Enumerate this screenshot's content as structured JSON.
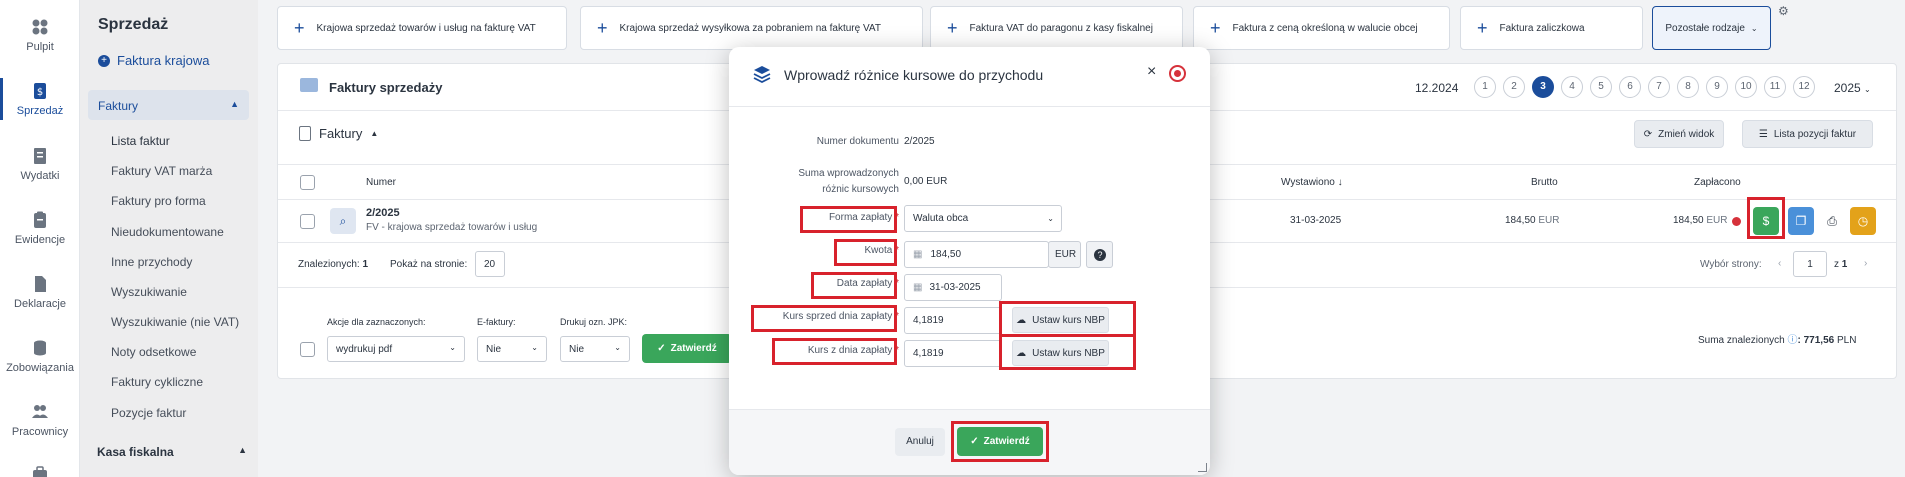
{
  "rail": {
    "items": [
      {
        "label": "Pulpit"
      },
      {
        "label": "Sprzedaż"
      },
      {
        "label": "Wydatki"
      },
      {
        "label": "Ewidencje"
      },
      {
        "label": "Deklaracje"
      },
      {
        "label": "Zobowiązania"
      },
      {
        "label": "Pracownicy"
      }
    ]
  },
  "sidebar": {
    "title": "Sprzedaż",
    "new_invoice": "Faktura krajowa",
    "group": "Faktury",
    "items": [
      "Lista faktur",
      "Faktury VAT marża",
      "Faktury pro forma",
      "Nieudokumentowane",
      "Inne przychody",
      "Wyszukiwanie",
      "Wyszukiwanie (nie VAT)",
      "Noty odsetkowe",
      "Faktury cykliczne",
      "Pozycje faktur"
    ],
    "group2": "Kasa fiskalna"
  },
  "topbar": {
    "buttons": [
      "Krajowa sprzedaż towarów i usług na fakturę VAT",
      "Krajowa sprzedaż wysyłkowa za pobraniem na fakturę VAT",
      "Faktura VAT do paragonu z kasy fiskalnej",
      "Faktura z ceną określoną w walucie obcej",
      "Faktura zaliczkowa"
    ],
    "other": "Pozostałe rodzaje"
  },
  "panel": {
    "title": "Faktury sprzedaży",
    "period": "12.2024",
    "months": [
      "1",
      "2",
      "3",
      "4",
      "5",
      "6",
      "7",
      "8",
      "9",
      "10",
      "11",
      "12"
    ],
    "active_month": "3",
    "year": "2025",
    "subtitle": "Faktury",
    "change_view": "Zmień widok",
    "positions_list": "Lista pozycji faktur"
  },
  "table": {
    "headers": {
      "number": "Numer",
      "issued": "Wystawiono",
      "gross": "Brutto",
      "paid": "Zapłacono"
    },
    "row": {
      "number": "2/2025",
      "description": "FV - krajowa sprzedaż towarów i usług",
      "issued": "31-03-2025",
      "gross_value": "184,50",
      "gross_currency": "EUR",
      "paid_value": "184,50",
      "paid_currency": "EUR"
    }
  },
  "footer": {
    "found_label": "Znalezionych:",
    "found_count": "1",
    "per_page_label": "Pokaż na stronie:",
    "per_page": "20",
    "page_select_label": "Wybór strony:",
    "page": "1",
    "of_label": "z",
    "pages": "1",
    "actions_label": "Akcje dla zaznaczonych:",
    "actions_value": "wydrukuj pdf",
    "einvoice_label": "E-faktury:",
    "einvoice_value": "Nie",
    "jpk_label": "Drukuj ozn. JPK:",
    "jpk_value": "Nie",
    "confirm": "Zatwierdź",
    "sum_label": "Suma znalezionych",
    "sum_value": ": 771,56",
    "sum_currency": "PLN"
  },
  "modal": {
    "title": "Wprowadź różnice kursowe do przychodu",
    "doc_label": "Numer dokumentu",
    "doc_value": "2/2025",
    "sum_label_1": "Suma wprowadzonych",
    "sum_label_2": "różnic kursowych",
    "sum_value": "0,00 EUR",
    "payment_form_label": "Forma zapłaty",
    "payment_form_value": "Waluta obca",
    "amount_label": "Kwota",
    "amount_value": "184,50",
    "amount_currency": "EUR",
    "date_label": "Data zapłaty",
    "date_value": "31-03-2025",
    "rate_sale_label": "Kurs sprzed dnia zapłaty",
    "rate_sale_value": "4,1819",
    "rate_pay_label": "Kurs z dnia zapłaty",
    "rate_pay_value": "4,1819",
    "nbp_button": "Ustaw kurs NBP",
    "required_mark": "*",
    "cancel": "Anuluj",
    "confirm": "Zatwierdź"
  },
  "colors": {
    "brand": "#1b4d9b",
    "success": "#3aa65b",
    "highlight": "#d8222c",
    "status_dot": "#d6323b"
  }
}
